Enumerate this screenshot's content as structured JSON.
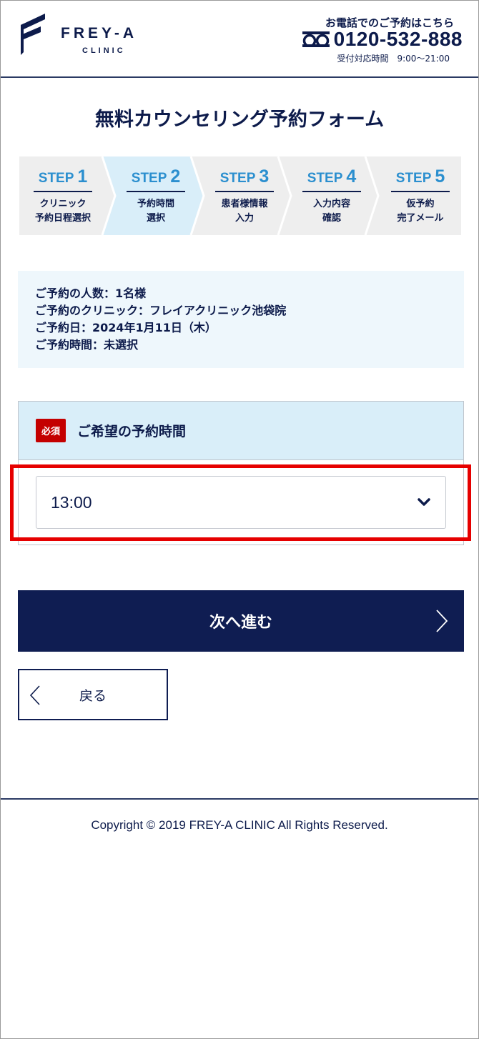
{
  "header": {
    "logo_name": "FREY-A",
    "logo_sub": "CLINIC",
    "tel_label": "お電話でのご予約はこちら",
    "tel_number": "0120-532-888",
    "tel_hours": "受付対応時間　9:00〜21:00"
  },
  "page_title": "無料カウンセリング予約フォーム",
  "steps": [
    {
      "prefix": "STEP ",
      "num": "1",
      "label": "クリニック\n予約日程選択",
      "active": false
    },
    {
      "prefix": "STEP ",
      "num": "2",
      "label": "予約時間\n選択",
      "active": true
    },
    {
      "prefix": "STEP ",
      "num": "3",
      "label": "患者様情報\n入力",
      "active": false
    },
    {
      "prefix": "STEP ",
      "num": "4",
      "label": "入力内容\n確認",
      "active": false
    },
    {
      "prefix": "STEP ",
      "num": "5",
      "label": "仮予約\n完了メール",
      "active": false
    }
  ],
  "summary": {
    "people": "ご予約の人数：1名様",
    "clinic": "ご予約のクリニック：フレイアクリニック池袋院",
    "date": "ご予約日：2024年1月11日（木）",
    "time": "ご予約時間：未選択"
  },
  "time_section": {
    "required_badge": "必須",
    "label": "ご希望の予約時間",
    "selected_value": "13:00"
  },
  "buttons": {
    "next_label": "次へ進む",
    "back_label": "戻る"
  },
  "footer": {
    "copyright": "Copyright © 2019 FREY-A CLINIC All Rights Reserved."
  },
  "colors": {
    "navy": "#0f1d52",
    "step_active": "#d9eef9",
    "step_inactive": "#eeeeee",
    "step_number": "#2b8fcf",
    "required": "#c40000",
    "highlight": "#e60000"
  }
}
